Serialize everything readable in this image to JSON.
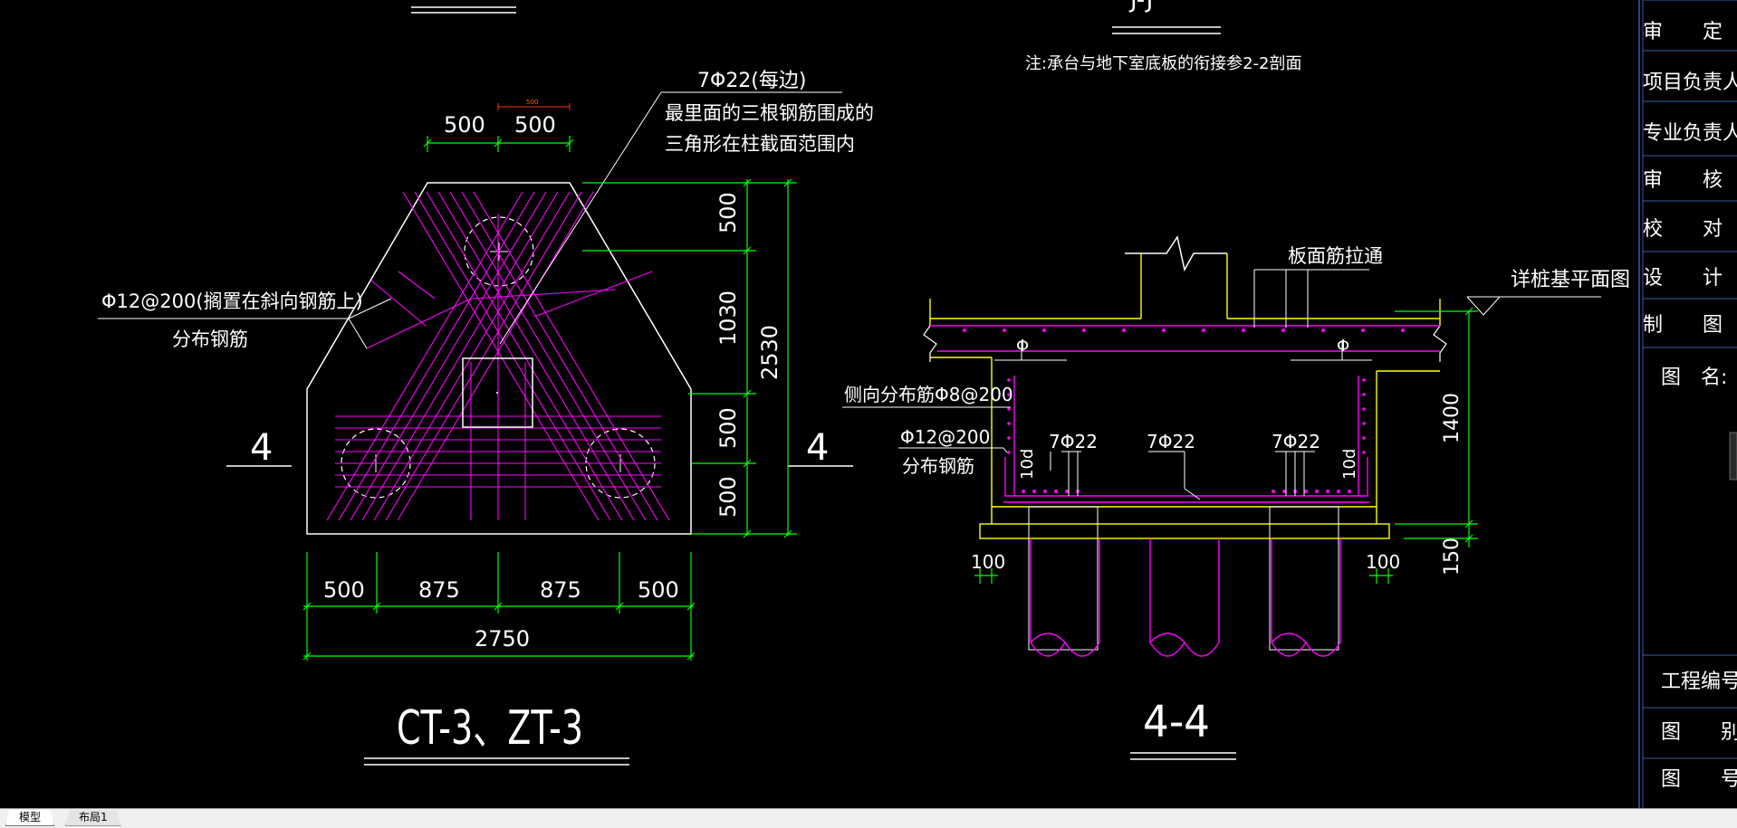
{
  "colors": {
    "background": "#000000",
    "outline": "#ffffff",
    "rebar": "#ff00ff",
    "dimension": "#00ff00",
    "text": "#ffffff",
    "leader_red": "#ff3300",
    "yellow": "#ffff00"
  },
  "plan": {
    "label_bar": "7Φ22(每边)",
    "note_line1": "最里面的三根钢筋围成的",
    "note_line2": "三角形在柱截面范围内",
    "label_dist": "Φ12@200(搁置在斜向钢筋上)",
    "label_dist2": "分布钢筋",
    "dim_top_1": "500",
    "dim_top_2": "500",
    "dim_top_small": "500",
    "dim_right_1": "500",
    "dim_right_2": "1030",
    "dim_right_3": "500",
    "dim_right_4": "500",
    "dim_right_total": "2530",
    "dim_bottom_1": "500",
    "dim_bottom_2": "875",
    "dim_bottom_3": "875",
    "dim_bottom_4": "500",
    "dim_bottom_total": "2750",
    "section_mark_left": "4",
    "section_mark_right": "4",
    "title": "CT-3、ZT-3"
  },
  "section": {
    "note": "注:承台与地下室底板的衔接参2-2剖面",
    "top_title_partial": "J-J",
    "label_slab": "板面筋拉通",
    "label_pile_plan": "详桩基平面图",
    "label_phi_left": "Φ",
    "label_phi_right": "Φ",
    "label_side_bar": "侧向分布筋Φ8@200",
    "label_dist": "Φ12@200",
    "label_dist2": "分布钢筋",
    "label_bar_1": "7Φ22",
    "label_bar_2": "7Φ22",
    "label_bar_3": "7Φ22",
    "label_10d_left": "10d",
    "label_10d_right": "10d",
    "dim_height": "1400",
    "dim_bottom": "150",
    "dim_left_100": "100",
    "dim_right_100": "100",
    "title": "4-4"
  },
  "title_block": {
    "rows": [
      "审　　定",
      "项目负责人",
      "专业负责人",
      "审　　核",
      "校　　对",
      "设　　计",
      "制　　图"
    ],
    "drawing_name": "图　名:",
    "project_no": "工程编号",
    "category": "图　　别",
    "drawing_no": "图　　号"
  },
  "tabs": {
    "model": "模型",
    "layout1": "布局1"
  }
}
